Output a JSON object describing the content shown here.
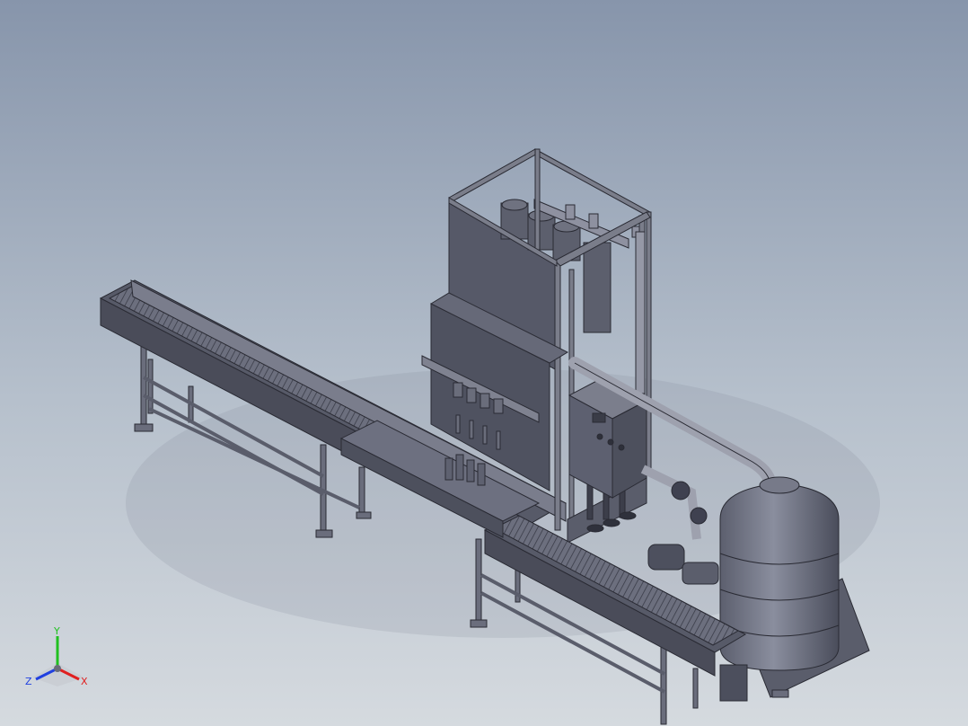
{
  "triad": {
    "x_label": "X",
    "y_label": "Y",
    "z_label": "Z",
    "x_color": "#e02020",
    "y_color": "#20c020",
    "z_color": "#2040e0"
  }
}
